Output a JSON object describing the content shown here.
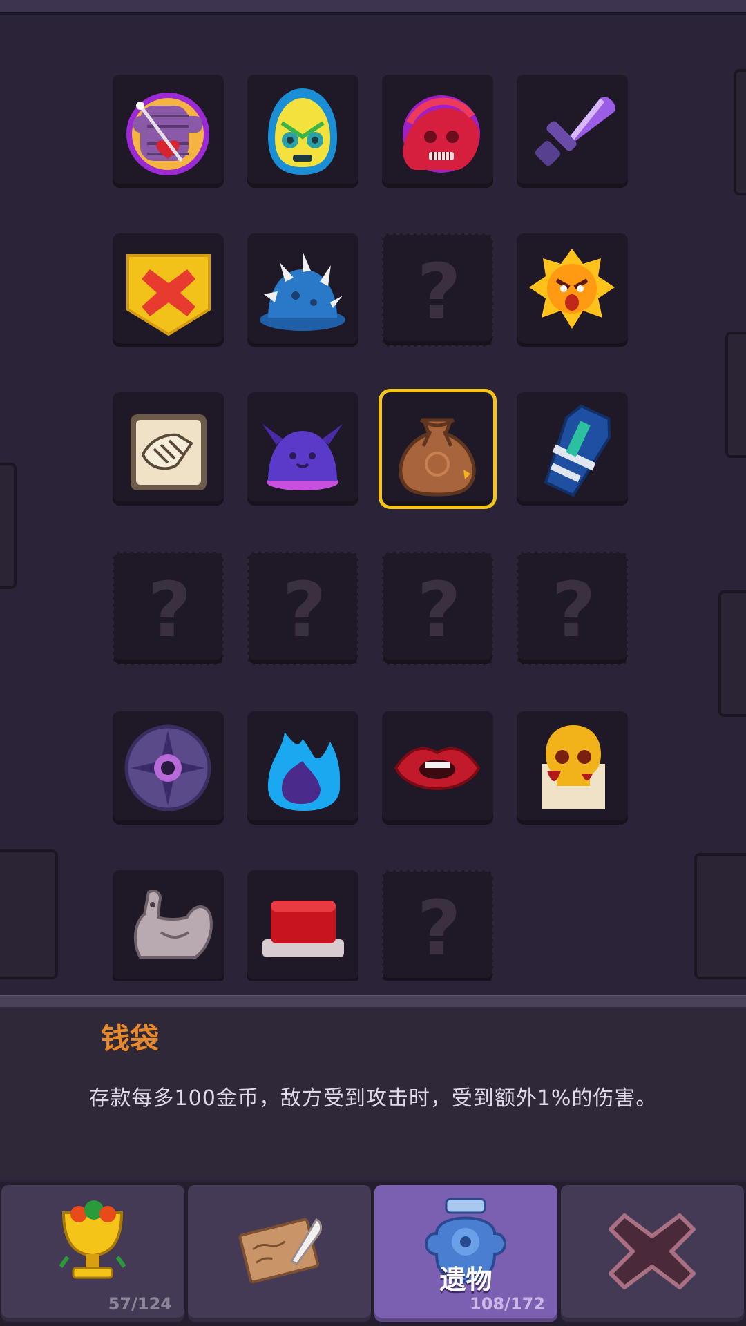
{
  "relics": [
    {
      "name": "voodoo-doll-relic-icon",
      "unlocked": true
    },
    {
      "name": "lucha-mask-relic-icon",
      "unlocked": true
    },
    {
      "name": "red-ghost-relic-icon",
      "unlocked": true
    },
    {
      "name": "purple-dagger-relic-icon",
      "unlocked": true
    },
    {
      "name": "cross-shield-relic-icon",
      "unlocked": true
    },
    {
      "name": "spiked-helmet-relic-icon",
      "unlocked": true
    },
    {
      "name": "locked-relic",
      "unlocked": false
    },
    {
      "name": "angry-sun-relic-icon",
      "unlocked": true
    },
    {
      "name": "handshake-relic-icon",
      "unlocked": true
    },
    {
      "name": "bat-helmet-relic-icon",
      "unlocked": true
    },
    {
      "name": "money-bag-relic-icon",
      "unlocked": true,
      "selected": true
    },
    {
      "name": "coffin-relic-icon",
      "unlocked": true
    },
    {
      "name": "locked-relic",
      "unlocked": false
    },
    {
      "name": "locked-relic",
      "unlocked": false
    },
    {
      "name": "locked-relic",
      "unlocked": false
    },
    {
      "name": "locked-relic",
      "unlocked": false
    },
    {
      "name": "eye-compass-relic-icon",
      "unlocked": true
    },
    {
      "name": "blue-flame-relic-icon",
      "unlocked": true
    },
    {
      "name": "red-lips-relic-icon",
      "unlocked": true
    },
    {
      "name": "skull-scroll-relic-icon",
      "unlocked": true
    },
    {
      "name": "stone-rooster-relic-icon",
      "unlocked": true
    },
    {
      "name": "red-button-relic-icon",
      "unlocked": true
    },
    {
      "name": "locked-relic",
      "unlocked": false
    }
  ],
  "locked_symbol": "?",
  "selected_item": {
    "title": "钱袋",
    "description": "存款每多100金币，敌方受到攻击时，受到额外1%的伤害。"
  },
  "tabs": {
    "trophies": {
      "icon": "golden-chalice-icon",
      "count": "57/124"
    },
    "notes": {
      "icon": "scroll-quill-icon",
      "count": ""
    },
    "relics": {
      "icon": "blue-urn-icon",
      "label": "遗物",
      "count": "108/172"
    },
    "close": {
      "icon": "close-x-icon"
    }
  },
  "colors": {
    "selection": "#f5c419",
    "title": "#e88a2a",
    "active_tab": "#7b5fb0"
  }
}
